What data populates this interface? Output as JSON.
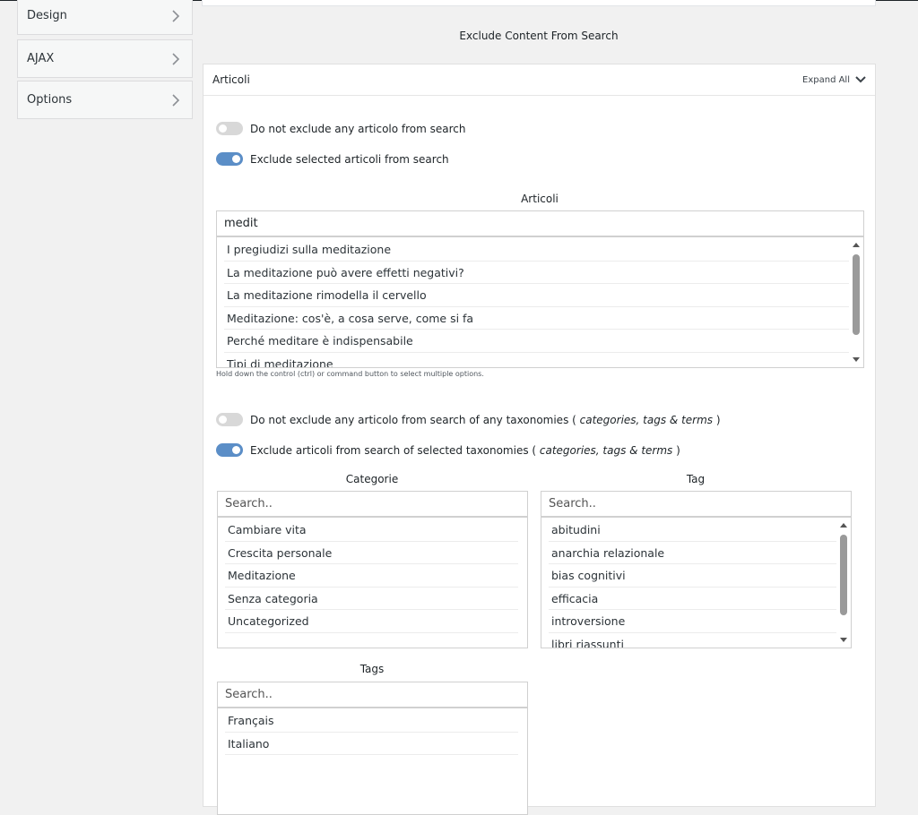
{
  "sidebar": {
    "items": [
      {
        "label": "Design"
      },
      {
        "label": "AJAX"
      },
      {
        "label": "Options"
      }
    ]
  },
  "section_title": "Exclude Content From Search",
  "panel": {
    "title": "Articoli",
    "expand_label": "Expand All"
  },
  "toggles": {
    "not_exclude": {
      "label": "Do not exclude any articolo from search",
      "on": false
    },
    "exclude_selected": {
      "label": "Exclude selected articoli from search",
      "on": true
    },
    "not_exclude_tax": {
      "label_main": "Do not exclude any articolo from search of any taxonomies ( ",
      "label_em": "categories, tags & terms",
      "label_end": " )",
      "on": false
    },
    "exclude_tax": {
      "label_main": "Exclude articoli from search of selected taxonomies ( ",
      "label_em": "categories, tags & terms",
      "label_end": " )",
      "on": true
    }
  },
  "articoli": {
    "heading": "Articoli",
    "search_value": "medit",
    "items": [
      "I pregiudizi sulla meditazione",
      "La meditazione può avere effetti negativi?",
      "La meditazione rimodella il cervello",
      "Meditazione: cos'è, a cosa serve, come si fa",
      "Perché meditare è indispensabile",
      "Tipi di meditazione"
    ],
    "hint": "Hold down the control (ctrl) or command button to select multiple options."
  },
  "categorie": {
    "heading": "Categorie",
    "placeholder": "Search..",
    "items": [
      "Cambiare vita",
      "Crescita personale",
      "Meditazione",
      "Senza categoria",
      "Uncategorized"
    ]
  },
  "tag": {
    "heading": "Tag",
    "placeholder": "Search..",
    "items": [
      "abitudini",
      "anarchia relazionale",
      "bias cognitivi",
      "efficacia",
      "introversione",
      "libri riassunti"
    ]
  },
  "tags": {
    "heading": "Tags",
    "placeholder": "Search..",
    "items": [
      "Français",
      "Italiano"
    ]
  },
  "colors": {
    "accent": "#5b8ec7",
    "background": "#f1f1f1"
  }
}
